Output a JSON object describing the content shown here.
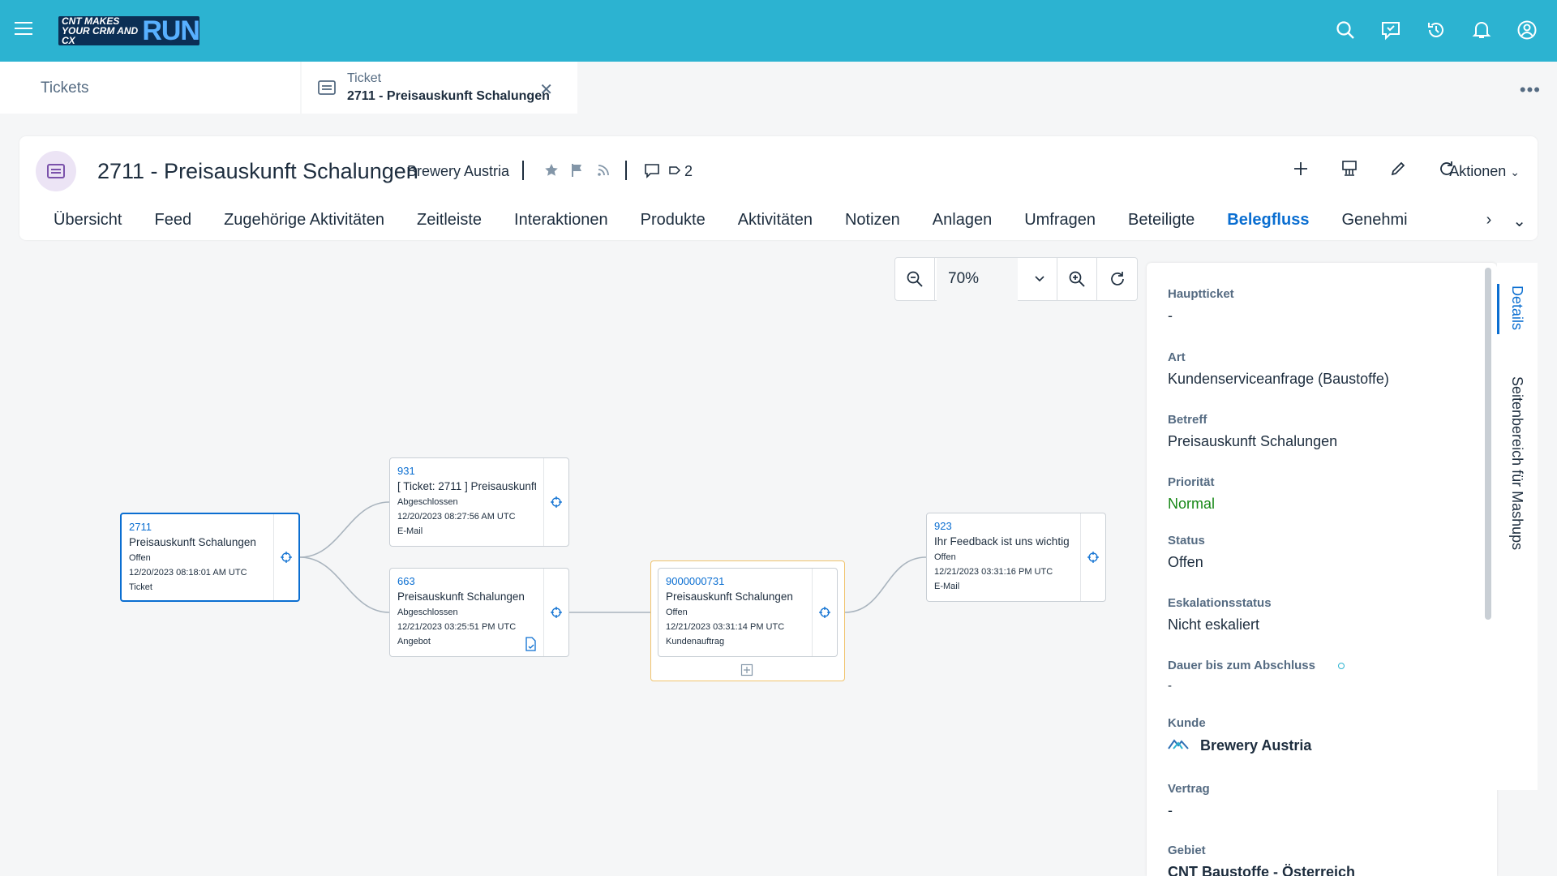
{
  "shell": {
    "logo_small": "CNT makes your CRM and CX",
    "logo_big": "RUN"
  },
  "tabs": {
    "tickets": "Tickets",
    "active_type": "Ticket",
    "active_title": "2711 - Preisauskunft Schalungen"
  },
  "header": {
    "title": "2711 - Preisauskunft Schalungen",
    "subtitle": "Brewery Austria",
    "count": "2",
    "aktionen": "Aktionen"
  },
  "nav": {
    "items": [
      "Übersicht",
      "Feed",
      "Zugehörige Aktivitäten",
      "Zeitleiste",
      "Interaktionen",
      "Produkte",
      "Aktivitäten",
      "Notizen",
      "Anlagen",
      "Umfragen",
      "Beteiligte",
      "Belegfluss",
      "Genehmi"
    ],
    "active_index": 11
  },
  "zoom": {
    "value": "70%"
  },
  "flow": {
    "nodes": [
      {
        "id": "2711",
        "name": "Preisauskunft Schalungen",
        "status": "Offen",
        "date": "12/20/2023 08:18:01 AM UTC",
        "type": "Ticket"
      },
      {
        "id": "931",
        "name": "[ Ticket: 2711 ] Preisauskunft ...",
        "status": "Abgeschlossen",
        "date": "12/20/2023 08:27:56 AM UTC",
        "type": "E-Mail"
      },
      {
        "id": "663",
        "name": "Preisauskunft Schalungen",
        "status": "Abgeschlossen",
        "date": "12/21/2023 03:25:51 PM UTC",
        "type": "Angebot"
      },
      {
        "id": "9000000731",
        "name": "Preisauskunft Schalungen",
        "status": "Offen",
        "date": "12/21/2023 03:31:14 PM UTC",
        "type": "Kundenauftrag"
      },
      {
        "id": "923",
        "name": "Ihr Feedback ist uns wichtig",
        "status": "Offen",
        "date": "12/21/2023 03:31:16 PM UTC",
        "type": "E-Mail"
      }
    ]
  },
  "details": {
    "hauptticket": {
      "label": "Hauptticket",
      "value": "-"
    },
    "art": {
      "label": "Art",
      "value": "Kundenserviceanfrage (Baustoffe)"
    },
    "betreff": {
      "label": "Betreff",
      "value": "Preisauskunft Schalungen"
    },
    "prioritaet": {
      "label": "Priorität",
      "value": "Normal"
    },
    "status": {
      "label": "Status",
      "value": "Offen"
    },
    "eskalation": {
      "label": "Eskalationsstatus",
      "value": "Nicht eskaliert"
    },
    "dauer": {
      "label": "Dauer bis zum Abschluss",
      "value": "-"
    },
    "kunde": {
      "label": "Kunde",
      "value": "Brewery Austria"
    },
    "vertrag": {
      "label": "Vertrag",
      "value": "-"
    },
    "gebiet": {
      "label": "Gebiet",
      "value": "CNT Baustoffe - Österreich"
    }
  },
  "side_tabs": {
    "details": "Details",
    "mashups": "Seitenbereich für Mashups"
  },
  "colors": {
    "shell": "#2cb3d1",
    "accent": "#0a6ed1",
    "positive": "#188918",
    "group_border": "#f0c36c"
  }
}
